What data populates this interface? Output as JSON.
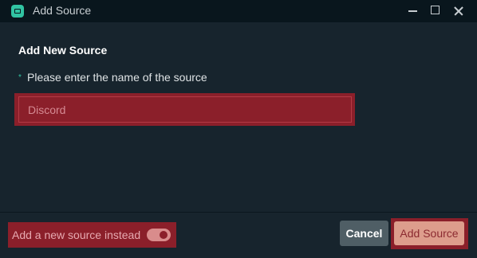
{
  "window": {
    "title": "Add Source",
    "app_icon": "streamlabs-icon"
  },
  "form": {
    "heading": "Add New Source",
    "required_marker": "*",
    "field_label": "Please enter the name of the source",
    "name_value": "",
    "name_placeholder": "Discord"
  },
  "footer": {
    "toggle_label": "Add a new source instead",
    "toggle_on": true,
    "cancel_label": "Cancel",
    "submit_label": "Add Source"
  },
  "colors": {
    "accent": "#31c3a2",
    "highlight": "#8b1f2a",
    "background": "#17242d",
    "titlebar": "#09161d"
  }
}
